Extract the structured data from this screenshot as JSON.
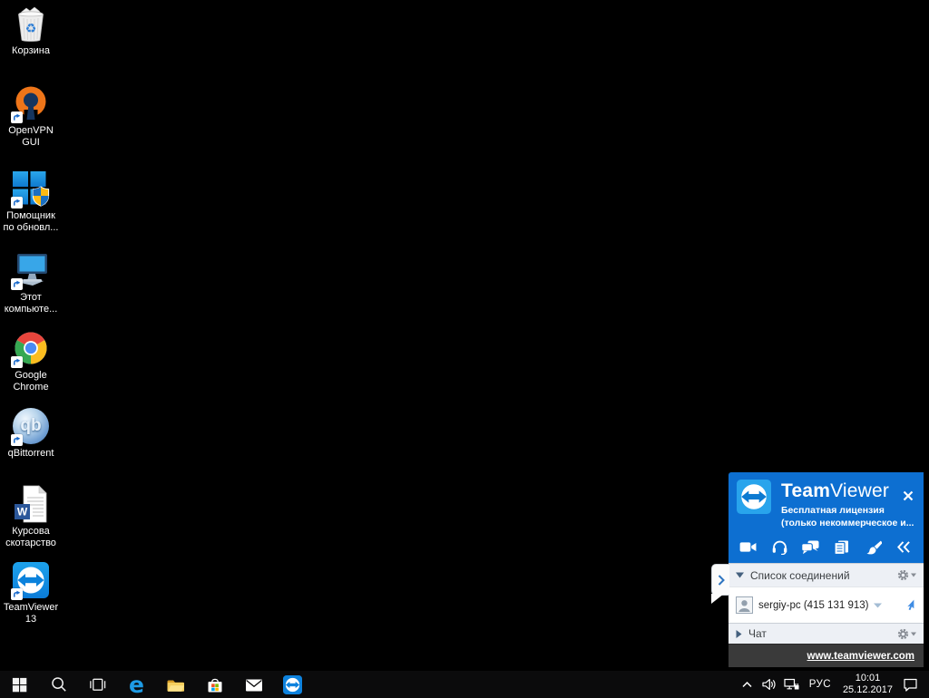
{
  "desktop": {
    "icons": [
      {
        "name": "recycle-bin",
        "label": "Корзина"
      },
      {
        "name": "openvpn-gui",
        "label": "OpenVPN\nGUI"
      },
      {
        "name": "update-assistant",
        "label": "Помощник\nпо обновл..."
      },
      {
        "name": "this-pc",
        "label": "Этот\nкомпьюте..."
      },
      {
        "name": "google-chrome",
        "label": "Google\nChrome"
      },
      {
        "name": "qbittorrent",
        "label": "qBittorrent"
      },
      {
        "name": "word-document",
        "label": "Курсова\nскотарство"
      },
      {
        "name": "teamviewer-13",
        "label": "TeamViewer\n13"
      }
    ]
  },
  "teamviewer": {
    "brand_bold": "Team",
    "brand_light": "Viewer",
    "license_line1": "Бесплатная лицензия",
    "license_line2": "(только некоммерческое и...",
    "toolbar_icons": [
      "video-call",
      "audio-call",
      "chat",
      "copy",
      "whiteboard",
      "collapse"
    ],
    "connections_title": "Список соединений",
    "connection_name": "sergiy-pc (415 131 913)",
    "chat_title": "Чат",
    "footer_link": "www.teamviewer.com",
    "qb_letters": "qb",
    "word_letter": "W"
  },
  "taskbar": {
    "items": [
      "start",
      "search",
      "task-view",
      "edge",
      "file-explorer",
      "store",
      "mail",
      "teamviewer"
    ]
  },
  "tray": {
    "icons": [
      "chevron-up",
      "volume",
      "network-ethernet",
      "action-center"
    ],
    "language": "РУС",
    "time": "10:01",
    "date": "25.12.2017"
  },
  "colors": {
    "tv_header_blue": "#0d6fd1",
    "tv_logo_blue": "#28a4ec",
    "section_bg": "#edf0f5",
    "footer_dark": "#3a3a3a",
    "taskbar_bg": "#0b0b0c"
  }
}
